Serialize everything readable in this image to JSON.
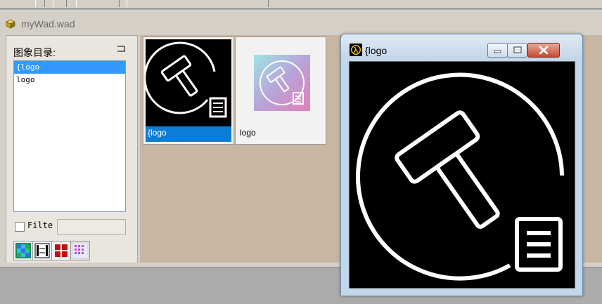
{
  "colors": {
    "selection": "#0c7cd5",
    "list_selection": "#3399ff",
    "thumb_area": "#c8b6a3",
    "close_button": "#c44b31"
  },
  "document": {
    "icon": "package-icon",
    "title": "myWad.wad"
  },
  "sidebar": {
    "caption": "图象目录:",
    "pin_icon": "pin-icon",
    "list_items": [
      {
        "label": "{logo",
        "selected": true
      },
      {
        "label": "logo",
        "selected": false
      }
    ],
    "filter_label": "Filte",
    "filter_value": "",
    "filter_checked": false,
    "tool_buttons": [
      {
        "icon": "color-grid-icon"
      },
      {
        "icon": "film-strip-icon"
      },
      {
        "icon": "red-tiles-icon"
      },
      {
        "icon": "purple-grid-icon"
      }
    ]
  },
  "thumbnails": [
    {
      "label": "{logo",
      "selected": true,
      "style": "black-white-outline"
    },
    {
      "label": "logo",
      "selected": false,
      "style": "gradient"
    }
  ],
  "preview_window": {
    "icon": "half-life-lambda-icon",
    "title": "{logo",
    "buttons": [
      "minimize-icon",
      "maximize-icon",
      "close-icon"
    ]
  }
}
